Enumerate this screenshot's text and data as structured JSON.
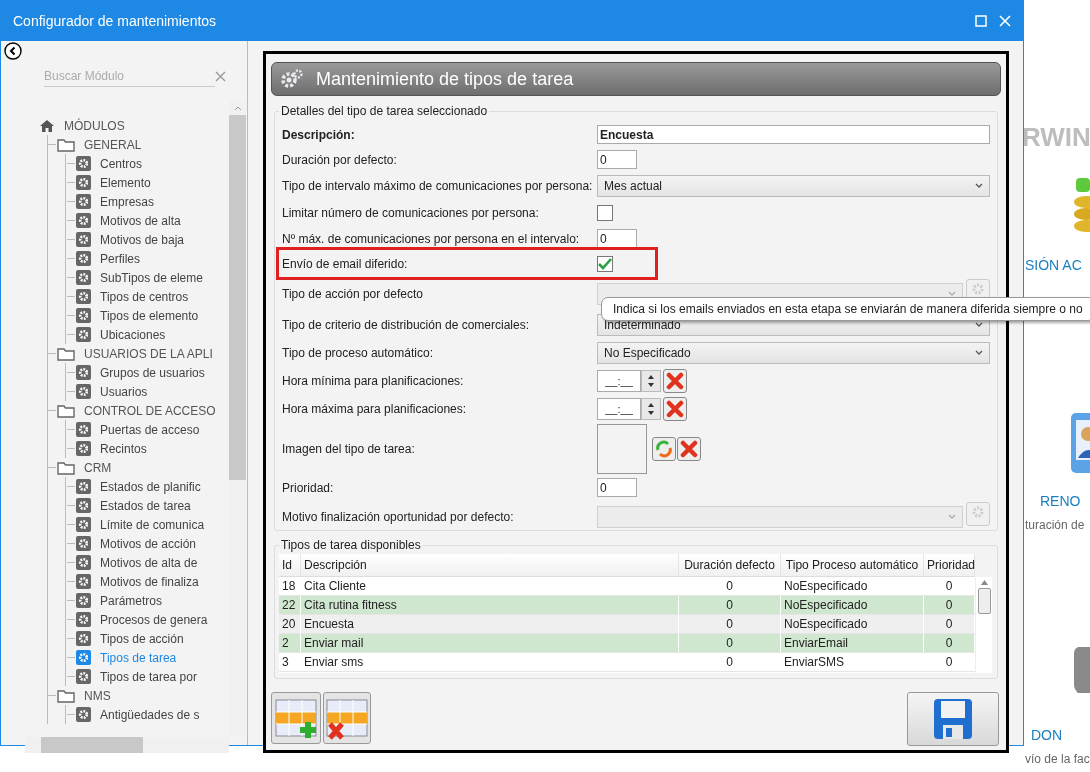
{
  "window": {
    "title": "Configurador de mantenimientos"
  },
  "sidebar": {
    "search": {
      "placeholder": "Buscar Módulo"
    },
    "tree": [
      {
        "label": "MÓDULOS",
        "kind": "root",
        "selected": false,
        "children": [
          {
            "label": "GENERAL",
            "kind": "folder",
            "selected": false,
            "children": [
              {
                "label": "Centros",
                "kind": "module",
                "selected": false
              },
              {
                "label": "Elemento",
                "kind": "module",
                "selected": false
              },
              {
                "label": "Empresas",
                "kind": "module",
                "selected": false
              },
              {
                "label": "Motivos de alta",
                "kind": "module",
                "selected": false
              },
              {
                "label": "Motivos de baja",
                "kind": "module",
                "selected": false
              },
              {
                "label": "Perfiles",
                "kind": "module",
                "selected": false
              },
              {
                "label": "SubTipos de eleme",
                "kind": "module",
                "selected": false
              },
              {
                "label": "Tipos de centros",
                "kind": "module",
                "selected": false
              },
              {
                "label": "Tipos de elemento",
                "kind": "module",
                "selected": false
              },
              {
                "label": "Ubicaciones",
                "kind": "module",
                "selected": false
              }
            ]
          },
          {
            "label": "USUARIOS DE LA APLI",
            "kind": "folder",
            "selected": false,
            "children": [
              {
                "label": "Grupos de usuarios",
                "kind": "module",
                "selected": false
              },
              {
                "label": "Usuarios",
                "kind": "module",
                "selected": false
              }
            ]
          },
          {
            "label": "CONTROL DE ACCESO",
            "kind": "folder",
            "selected": false,
            "children": [
              {
                "label": "Puertas de acceso",
                "kind": "module",
                "selected": false
              },
              {
                "label": "Recintos",
                "kind": "module",
                "selected": false
              }
            ]
          },
          {
            "label": "CRM",
            "kind": "folder",
            "selected": false,
            "children": [
              {
                "label": "Estados de planific",
                "kind": "module",
                "selected": false
              },
              {
                "label": "Estados de tarea",
                "kind": "module",
                "selected": false
              },
              {
                "label": "Límite de comunica",
                "kind": "module",
                "selected": false
              },
              {
                "label": "Motivos de acción",
                "kind": "module",
                "selected": false
              },
              {
                "label": "Motivos de alta de",
                "kind": "module",
                "selected": false
              },
              {
                "label": "Motivos de finaliza",
                "kind": "module",
                "selected": false
              },
              {
                "label": "Parámetros",
                "kind": "module",
                "selected": false
              },
              {
                "label": "Procesos de genera",
                "kind": "module",
                "selected": false
              },
              {
                "label": "Tipos de acción",
                "kind": "module",
                "selected": false
              },
              {
                "label": "Tipos de tarea",
                "kind": "module",
                "selected": true
              },
              {
                "label": "Tipos de tarea por",
                "kind": "module",
                "selected": false
              }
            ]
          },
          {
            "label": "NMS",
            "kind": "folder",
            "selected": false,
            "children": [
              {
                "label": "Antigüedades de s",
                "kind": "module",
                "selected": false
              }
            ]
          }
        ]
      }
    ]
  },
  "panel": {
    "title": "Mantenimiento de tipos de tarea",
    "details": {
      "legend": "Detalles del tipo de tarea seleccionado",
      "fields": [
        {
          "label": "Descripción:",
          "kind": "text",
          "value": "Encuesta",
          "wide": true,
          "highlighted": false
        },
        {
          "label": "Duración por defecto:",
          "kind": "text",
          "value": "0",
          "wide": false,
          "highlighted": false
        },
        {
          "label": "Tipo de intervalo máximo de comunicaciones por persona:",
          "kind": "select",
          "value": "Mes actual",
          "highlighted": false
        },
        {
          "label": "Limitar número de comunicaciones por persona:",
          "kind": "checkbox",
          "checked": false,
          "highlighted": false
        },
        {
          "label": "Nº máx. de comunicaciones por persona en el intervalo:",
          "kind": "text",
          "value": "0",
          "wide": false,
          "highlighted": false
        },
        {
          "label": "Envío de email diferido:",
          "kind": "checkbox",
          "checked": true,
          "highlighted": true
        },
        {
          "label": "Tipo de acción por defecto",
          "kind": "combo",
          "highlighted": false
        },
        {
          "label": "Tipo de criterio de distribución de comerciales:",
          "kind": "select",
          "value": "Indeterminado",
          "highlighted": false
        },
        {
          "label": "Tipo de proceso automático:",
          "kind": "select",
          "value": "No Especificado",
          "highlighted": false
        },
        {
          "label": "Hora mínima para planificaciones:",
          "kind": "time",
          "value": "__:__",
          "highlighted": false
        },
        {
          "label": "Hora máxima para planificaciones:",
          "kind": "time",
          "value": "__:__",
          "highlighted": false
        },
        {
          "label": "Imagen del tipo de tarea:",
          "kind": "image",
          "highlighted": false
        },
        {
          "label": "Prioridad:",
          "kind": "text",
          "value": "0",
          "wide": false,
          "highlighted": false
        },
        {
          "label": "Motivo finalización oportunidad por defecto:",
          "kind": "combo",
          "highlighted": false
        }
      ],
      "tooltip": "Indica si los emails enviados en esta etapa se enviarán de manera diferida siempre o no"
    },
    "table": {
      "legend": "Tipos de tarea disponibles",
      "columns": [
        "Id",
        "Descripción",
        "Duración defecto",
        "Tipo Proceso automático",
        "Prioridad"
      ],
      "rows": [
        {
          "cells": [
            "18",
            "Cita Cliente",
            "0",
            "NoEspecificado",
            "0"
          ],
          "selected": false
        },
        {
          "cells": [
            "22",
            "Cita rutina fitness",
            "0",
            "NoEspecificado",
            "0"
          ],
          "selected": false
        },
        {
          "cells": [
            "20",
            "Encuesta",
            "0",
            "NoEspecificado",
            "0"
          ],
          "selected": true
        },
        {
          "cells": [
            "2",
            "Enviar mail",
            "0",
            "EnviarEmail",
            "0"
          ],
          "selected": false
        },
        {
          "cells": [
            "3",
            "Enviar sms",
            "0",
            "EnviarSMS",
            "0"
          ],
          "selected": false
        }
      ]
    }
  },
  "background": {
    "texts": [
      {
        "text": "RWIN",
        "kind": "logo"
      },
      {
        "text": "SIÓN AC",
        "kind": "heading"
      },
      {
        "text": "RENO",
        "kind": "heading"
      },
      {
        "text": "turación de",
        "kind": "caption"
      },
      {
        "text": "DON",
        "kind": "heading"
      },
      {
        "text": "vío de la fac",
        "kind": "caption"
      }
    ]
  }
}
